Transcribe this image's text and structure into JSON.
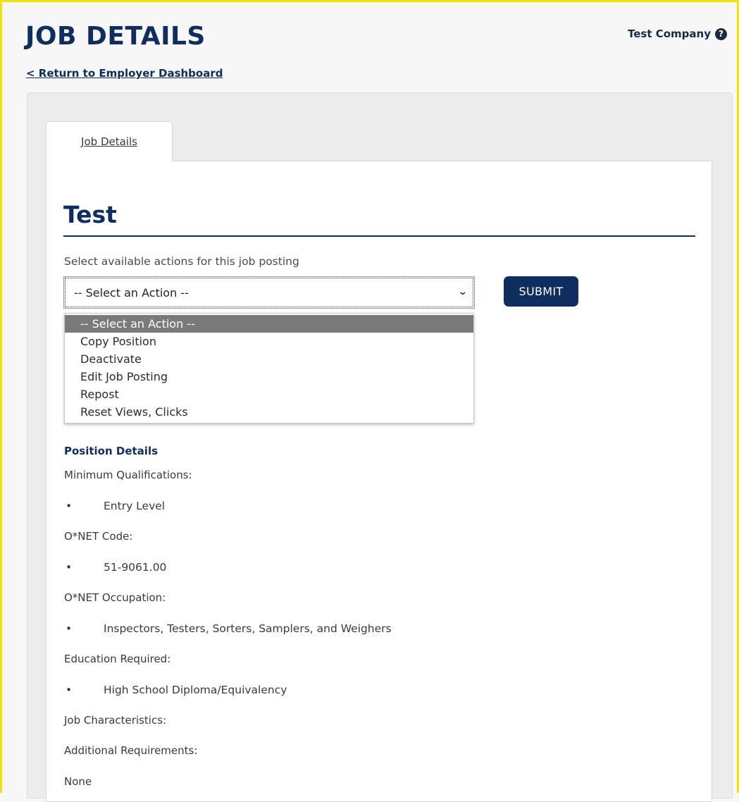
{
  "header": {
    "title": "JOB DETAILS",
    "company": "Test Company",
    "help_icon": "question-circle-icon",
    "return_link": "< Return to Employer Dashboard"
  },
  "tabs": [
    {
      "label": "Job Details",
      "active": true
    }
  ],
  "job": {
    "title": "Test",
    "action_label": "Select available actions for this job posting",
    "select_value": "-- Select an Action --",
    "submit_label": "SUBMIT",
    "action_options": [
      "-- Select an Action --",
      "Copy Position",
      "Deactivate",
      "Edit Job Posting",
      "Repost",
      "Reset Views, Clicks"
    ]
  },
  "position_details": {
    "heading": "Position Details",
    "min_qual_label": "Minimum Qualifications:",
    "min_qual_value": "Entry Level",
    "onet_code_label": "O*NET Code:",
    "onet_code_value": "51-9061.00",
    "onet_occ_label": "O*NET Occupation:",
    "onet_occ_value": "Inspectors, Testers, Sorters, Samplers, and Weighers",
    "education_label": "Education Required:",
    "education_value": "High School Diploma/Equivalency",
    "characteristics_label": "Job Characteristics:",
    "additional_label": "Additional Requirements:",
    "additional_value": "None",
    "bullet": "•"
  },
  "colors": {
    "brand": "#0f2d5e",
    "frame": "#f2e300"
  }
}
